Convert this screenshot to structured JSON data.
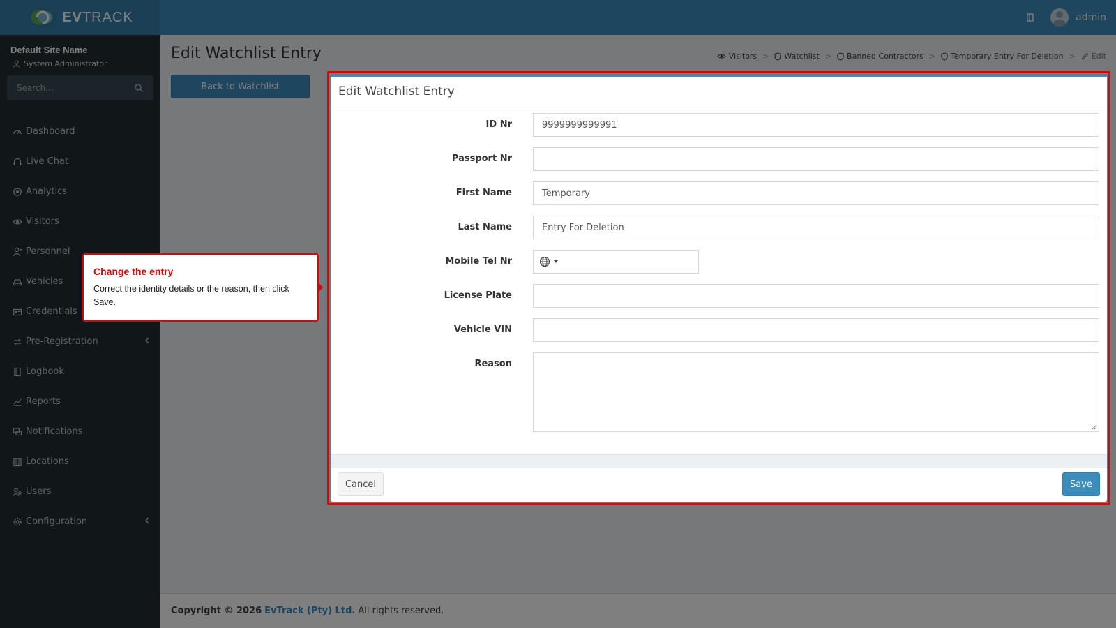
{
  "header": {
    "logo_text_bold": "EV",
    "logo_text_rest": "TRACK",
    "user_name": "admin",
    "book_icon": "book-icon",
    "avatar_icon": "avatar"
  },
  "sidebar": {
    "site_name": "Default Site Name",
    "role": "System Administrator",
    "search_placeholder": "Search...",
    "items": [
      {
        "label": "Dashboard",
        "icon": "dashboard-icon"
      },
      {
        "label": "Live Chat",
        "icon": "headset-icon"
      },
      {
        "label": "Analytics",
        "icon": "target-icon"
      },
      {
        "label": "Visitors",
        "icon": "eye-icon"
      },
      {
        "label": "Personnel",
        "icon": "user-tie-icon"
      },
      {
        "label": "Vehicles",
        "icon": "car-icon"
      },
      {
        "label": "Credentials",
        "icon": "id-card-icon"
      },
      {
        "label": "Pre-Registration",
        "icon": "exchange-icon",
        "expandable": true
      },
      {
        "label": "Logbook",
        "icon": "book-icon"
      },
      {
        "label": "Reports",
        "icon": "chart-icon"
      },
      {
        "label": "Notifications",
        "icon": "chat-icon"
      },
      {
        "label": "Locations",
        "icon": "building-icon"
      },
      {
        "label": "Users",
        "icon": "users-icon"
      },
      {
        "label": "Configuration",
        "icon": "gear-icon",
        "expandable": true
      }
    ]
  },
  "page": {
    "title": "Edit Watchlist Entry",
    "back_button": "Back to Watchlist",
    "breadcrumb": [
      {
        "label": "Visitors",
        "icon": "eye-icon"
      },
      {
        "label": "Watchlist",
        "icon": "shield-icon"
      },
      {
        "label": "Banned Contractors",
        "icon": "shield-icon"
      },
      {
        "label": "Temporary Entry For Deletion",
        "icon": "shield-icon"
      },
      {
        "label": "Edit",
        "icon": "pencil-icon"
      }
    ]
  },
  "form": {
    "title": "Edit Watchlist Entry",
    "fields": {
      "id_nr": {
        "label": "ID Nr",
        "value": "9999999999991"
      },
      "passport_nr": {
        "label": "Passport Nr",
        "value": ""
      },
      "first_name": {
        "label": "First Name",
        "value": "Temporary"
      },
      "last_name": {
        "label": "Last Name",
        "value": "Entry For Deletion"
      },
      "mobile": {
        "label": "Mobile Tel Nr",
        "value": ""
      },
      "license_plate": {
        "label": "License Plate",
        "value": ""
      },
      "vehicle_vin": {
        "label": "Vehicle VIN",
        "value": ""
      },
      "reason": {
        "label": "Reason",
        "value": ""
      }
    },
    "cancel_label": "Cancel",
    "save_label": "Save"
  },
  "callout": {
    "title": "Change the entry",
    "body": "Correct the identity details or the reason, then click Save."
  },
  "footer": {
    "copyright": "Copyright © 2026",
    "company": "EvTrack (Pty) Ltd.",
    "rights": "All rights reserved."
  },
  "colors": {
    "header": "#3c8dbc",
    "sidebar": "#222d32",
    "highlight": "#e00000",
    "primary_button": "#3c8dbc"
  }
}
